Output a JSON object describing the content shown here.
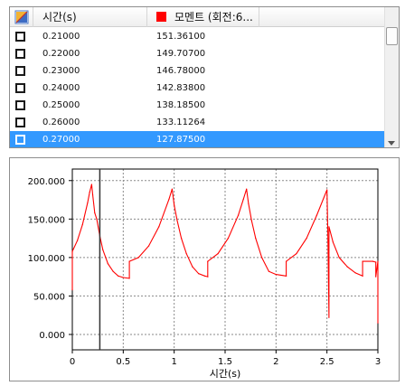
{
  "table": {
    "columns": {
      "time": "시간(s)",
      "moment": "모멘트 (회전:6..."
    },
    "rows": [
      {
        "time": "0.21000",
        "moment": "151.36100",
        "selected": false
      },
      {
        "time": "0.22000",
        "moment": "149.70700",
        "selected": false
      },
      {
        "time": "0.23000",
        "moment": "146.78000",
        "selected": false
      },
      {
        "time": "0.24000",
        "moment": "142.83800",
        "selected": false
      },
      {
        "time": "0.25000",
        "moment": "138.18500",
        "selected": false
      },
      {
        "time": "0.26000",
        "moment": "133.11264",
        "selected": false
      },
      {
        "time": "0.27000",
        "moment": "127.87500",
        "selected": true
      }
    ]
  },
  "colors": {
    "series": "#ff0000",
    "selection": "#3399ff",
    "cursor": "#333333"
  },
  "chart_data": {
    "type": "line",
    "xlabel": "시간(s)",
    "ylabel": "",
    "xlim": [
      0,
      3
    ],
    "ylim": [
      -20,
      215
    ],
    "xticks": [
      "0",
      "0.5",
      "1",
      "1.5",
      "2",
      "2.5",
      "3"
    ],
    "yticks": [
      "0.000",
      "50.000",
      "100.000",
      "150.000",
      "200.000"
    ],
    "grid": true,
    "cursor_x": 0.27,
    "series": [
      {
        "name": "모멘트 (회전:6...",
        "x": [
          0,
          0,
          0.05,
          0.1,
          0.15,
          0.17,
          0.19,
          0.2,
          0.22,
          0.24,
          0.27,
          0.3,
          0.35,
          0.4,
          0.45,
          0.5,
          0.56,
          0.56,
          0.65,
          0.75,
          0.85,
          0.95,
          0.98,
          1.0,
          1.03,
          1.07,
          1.12,
          1.18,
          1.24,
          1.3,
          1.33,
          1.33,
          1.43,
          1.53,
          1.63,
          1.68,
          1.71,
          1.73,
          1.76,
          1.8,
          1.86,
          1.93,
          2.0,
          2.1,
          2.1,
          2.2,
          2.3,
          2.4,
          2.5,
          2.51,
          2.52,
          2.52,
          2.56,
          2.62,
          2.7,
          2.78,
          2.85,
          2.85,
          2.95,
          2.98,
          2.98,
          3.0,
          3.0
        ],
        "y": [
          58,
          108,
          122,
          143,
          171,
          185,
          195,
          182,
          158,
          150,
          128,
          110,
          92,
          82,
          76,
          74,
          73,
          95,
          100,
          115,
          140,
          176,
          189,
          168,
          148,
          125,
          105,
          88,
          79,
          76,
          75,
          95,
          105,
          125,
          155,
          176,
          189,
          170,
          148,
          125,
          100,
          82,
          78,
          76,
          95,
          105,
          125,
          155,
          188,
          122,
          22,
          140,
          120,
          100,
          88,
          80,
          76,
          95,
          95,
          94,
          75,
          95,
          15
        ]
      }
    ]
  }
}
